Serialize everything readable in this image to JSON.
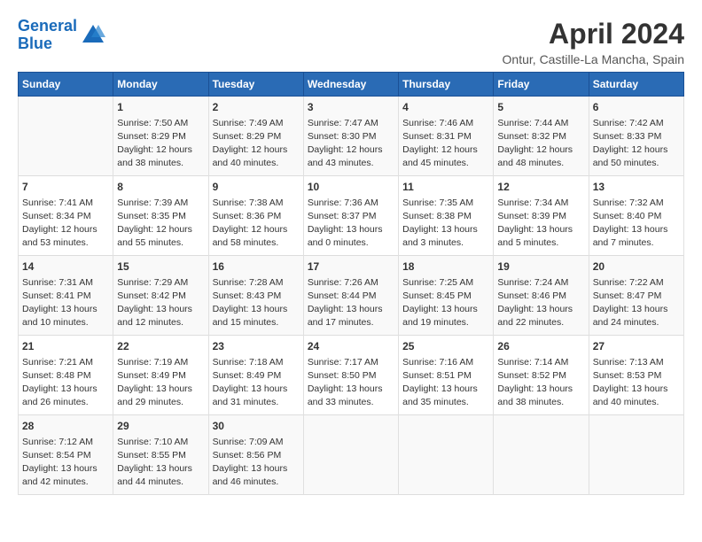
{
  "logo": {
    "line1": "General",
    "line2": "Blue"
  },
  "title": "April 2024",
  "subtitle": "Ontur, Castille-La Mancha, Spain",
  "days_of_week": [
    "Sunday",
    "Monday",
    "Tuesday",
    "Wednesday",
    "Thursday",
    "Friday",
    "Saturday"
  ],
  "weeks": [
    [
      {
        "day": "",
        "info": ""
      },
      {
        "day": "1",
        "info": "Sunrise: 7:50 AM\nSunset: 8:29 PM\nDaylight: 12 hours\nand 38 minutes."
      },
      {
        "day": "2",
        "info": "Sunrise: 7:49 AM\nSunset: 8:29 PM\nDaylight: 12 hours\nand 40 minutes."
      },
      {
        "day": "3",
        "info": "Sunrise: 7:47 AM\nSunset: 8:30 PM\nDaylight: 12 hours\nand 43 minutes."
      },
      {
        "day": "4",
        "info": "Sunrise: 7:46 AM\nSunset: 8:31 PM\nDaylight: 12 hours\nand 45 minutes."
      },
      {
        "day": "5",
        "info": "Sunrise: 7:44 AM\nSunset: 8:32 PM\nDaylight: 12 hours\nand 48 minutes."
      },
      {
        "day": "6",
        "info": "Sunrise: 7:42 AM\nSunset: 8:33 PM\nDaylight: 12 hours\nand 50 minutes."
      }
    ],
    [
      {
        "day": "7",
        "info": "Sunrise: 7:41 AM\nSunset: 8:34 PM\nDaylight: 12 hours\nand 53 minutes."
      },
      {
        "day": "8",
        "info": "Sunrise: 7:39 AM\nSunset: 8:35 PM\nDaylight: 12 hours\nand 55 minutes."
      },
      {
        "day": "9",
        "info": "Sunrise: 7:38 AM\nSunset: 8:36 PM\nDaylight: 12 hours\nand 58 minutes."
      },
      {
        "day": "10",
        "info": "Sunrise: 7:36 AM\nSunset: 8:37 PM\nDaylight: 13 hours\nand 0 minutes."
      },
      {
        "day": "11",
        "info": "Sunrise: 7:35 AM\nSunset: 8:38 PM\nDaylight: 13 hours\nand 3 minutes."
      },
      {
        "day": "12",
        "info": "Sunrise: 7:34 AM\nSunset: 8:39 PM\nDaylight: 13 hours\nand 5 minutes."
      },
      {
        "day": "13",
        "info": "Sunrise: 7:32 AM\nSunset: 8:40 PM\nDaylight: 13 hours\nand 7 minutes."
      }
    ],
    [
      {
        "day": "14",
        "info": "Sunrise: 7:31 AM\nSunset: 8:41 PM\nDaylight: 13 hours\nand 10 minutes."
      },
      {
        "day": "15",
        "info": "Sunrise: 7:29 AM\nSunset: 8:42 PM\nDaylight: 13 hours\nand 12 minutes."
      },
      {
        "day": "16",
        "info": "Sunrise: 7:28 AM\nSunset: 8:43 PM\nDaylight: 13 hours\nand 15 minutes."
      },
      {
        "day": "17",
        "info": "Sunrise: 7:26 AM\nSunset: 8:44 PM\nDaylight: 13 hours\nand 17 minutes."
      },
      {
        "day": "18",
        "info": "Sunrise: 7:25 AM\nSunset: 8:45 PM\nDaylight: 13 hours\nand 19 minutes."
      },
      {
        "day": "19",
        "info": "Sunrise: 7:24 AM\nSunset: 8:46 PM\nDaylight: 13 hours\nand 22 minutes."
      },
      {
        "day": "20",
        "info": "Sunrise: 7:22 AM\nSunset: 8:47 PM\nDaylight: 13 hours\nand 24 minutes."
      }
    ],
    [
      {
        "day": "21",
        "info": "Sunrise: 7:21 AM\nSunset: 8:48 PM\nDaylight: 13 hours\nand 26 minutes."
      },
      {
        "day": "22",
        "info": "Sunrise: 7:19 AM\nSunset: 8:49 PM\nDaylight: 13 hours\nand 29 minutes."
      },
      {
        "day": "23",
        "info": "Sunrise: 7:18 AM\nSunset: 8:49 PM\nDaylight: 13 hours\nand 31 minutes."
      },
      {
        "day": "24",
        "info": "Sunrise: 7:17 AM\nSunset: 8:50 PM\nDaylight: 13 hours\nand 33 minutes."
      },
      {
        "day": "25",
        "info": "Sunrise: 7:16 AM\nSunset: 8:51 PM\nDaylight: 13 hours\nand 35 minutes."
      },
      {
        "day": "26",
        "info": "Sunrise: 7:14 AM\nSunset: 8:52 PM\nDaylight: 13 hours\nand 38 minutes."
      },
      {
        "day": "27",
        "info": "Sunrise: 7:13 AM\nSunset: 8:53 PM\nDaylight: 13 hours\nand 40 minutes."
      }
    ],
    [
      {
        "day": "28",
        "info": "Sunrise: 7:12 AM\nSunset: 8:54 PM\nDaylight: 13 hours\nand 42 minutes."
      },
      {
        "day": "29",
        "info": "Sunrise: 7:10 AM\nSunset: 8:55 PM\nDaylight: 13 hours\nand 44 minutes."
      },
      {
        "day": "30",
        "info": "Sunrise: 7:09 AM\nSunset: 8:56 PM\nDaylight: 13 hours\nand 46 minutes."
      },
      {
        "day": "",
        "info": ""
      },
      {
        "day": "",
        "info": ""
      },
      {
        "day": "",
        "info": ""
      },
      {
        "day": "",
        "info": ""
      }
    ]
  ]
}
